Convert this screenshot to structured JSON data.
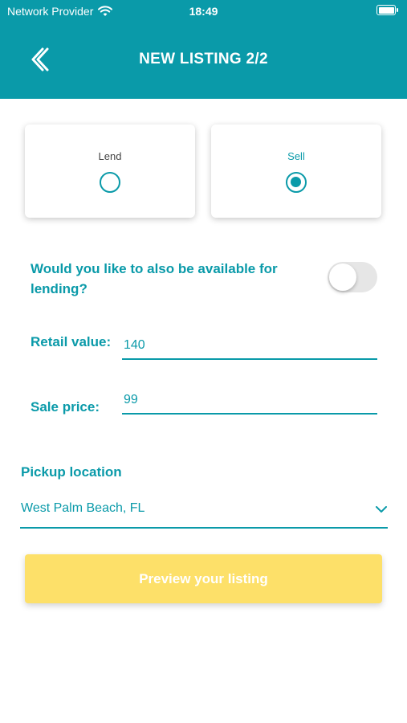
{
  "status_bar": {
    "carrier": "Network Provider",
    "time": "18:49"
  },
  "header": {
    "title": "NEW LISTING 2/2"
  },
  "options": {
    "lend_label": "Lend",
    "sell_label": "Sell",
    "selected": "Sell"
  },
  "lending": {
    "question": "Would you like to also be available for lending?",
    "enabled": false
  },
  "retail": {
    "label": "Retail value:",
    "value": "140"
  },
  "sale": {
    "label": "Sale price:",
    "value": "99"
  },
  "pickup": {
    "label": "Pickup location",
    "value": "West Palm Beach, FL"
  },
  "actions": {
    "preview_label": "Preview your listing"
  },
  "colors": {
    "primary": "#0a9aa9",
    "button": "#fde069",
    "toggle_off": "#e6e6e6"
  }
}
